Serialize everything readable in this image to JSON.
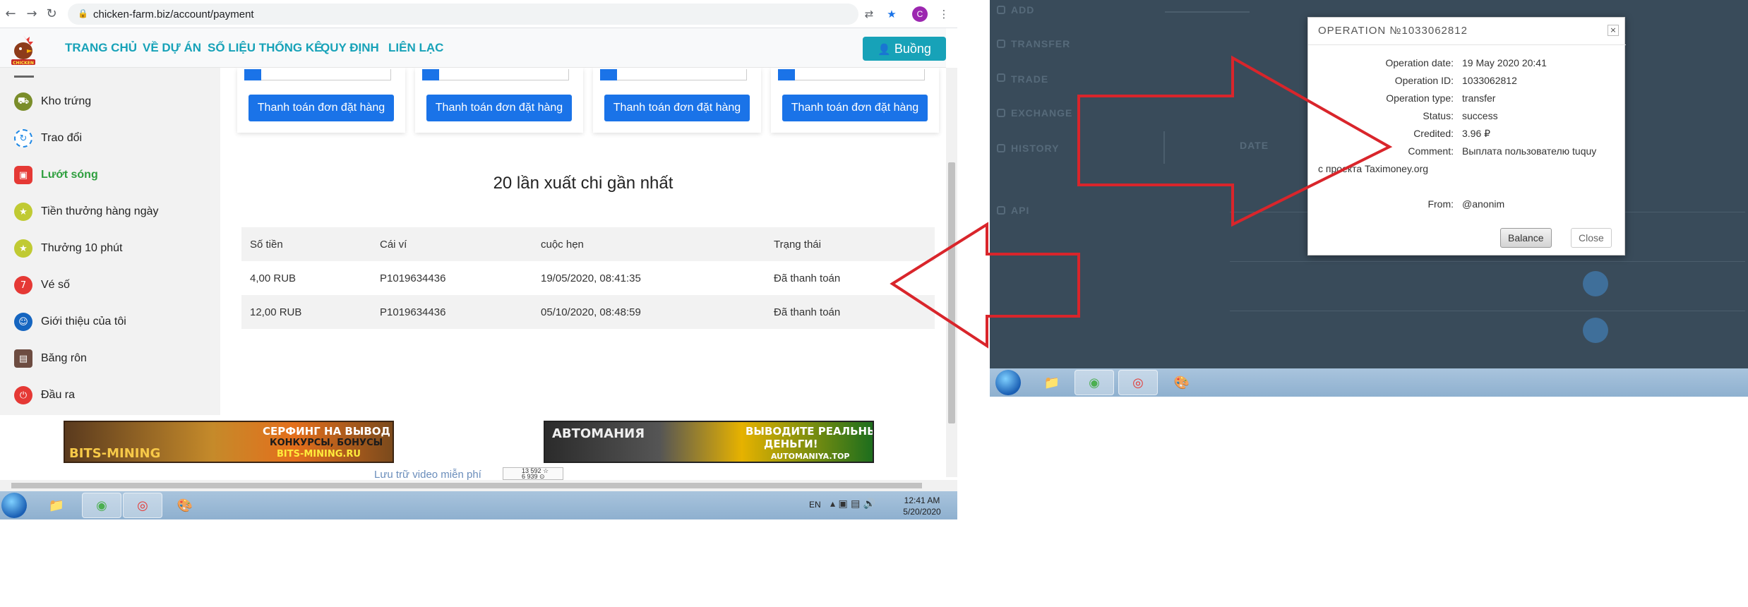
{
  "browser": {
    "url": "chicken-farm.biz/account/payment",
    "profile_initial": "C",
    "nav_back": "←",
    "nav_forward": "→",
    "nav_reload": "↻",
    "lock_icon": "🔒"
  },
  "site": {
    "nav": [
      "TRANG CHỦ",
      "VỀ DỰ ÁN",
      "SỐ LIỆU THỐNG KÊ",
      "QUY ĐỊNH",
      "LIÊN LẠC"
    ],
    "room_button": "Buồng",
    "logo_text": "CHICKEN"
  },
  "sidebar": {
    "items": [
      {
        "label": "Kho trứng",
        "icon": "egg-cart-icon",
        "color": "#7a8d2a"
      },
      {
        "label": "Trao đổi",
        "icon": "exchange-icon",
        "color": "#1e88e5"
      },
      {
        "label": "Lướt sóng",
        "icon": "surf-icon",
        "color": "#e53935",
        "active": true
      },
      {
        "label": "Tiền thưởng hàng ngày",
        "icon": "daily-bonus-icon",
        "color": "#c0ca33"
      },
      {
        "label": "Thưởng 10 phút",
        "icon": "ten-minute-bonus-icon",
        "color": "#c0ca33"
      },
      {
        "label": "Vé số",
        "icon": "lottery-icon",
        "color": "#e53935"
      },
      {
        "label": "Giới thiệu của tôi",
        "icon": "referral-icon",
        "color": "#1565c0"
      },
      {
        "label": "Băng rôn",
        "icon": "banner-icon",
        "color": "#6d4c41"
      },
      {
        "label": "Đầu ra",
        "icon": "logout-icon",
        "color": "#e53935"
      }
    ]
  },
  "payment_cards": [
    {
      "button": "Thanh toán đơn đặt hàng"
    },
    {
      "button": "Thanh toán đơn đặt hàng"
    },
    {
      "button": "Thanh toán đơn đặt hàng"
    },
    {
      "button": "Thanh toán đơn đặt hàng"
    }
  ],
  "history": {
    "title": "20 lần xuất chi gần nhất",
    "columns": [
      "Số tiền",
      "Cái ví",
      "cuộc hẹn",
      "Trạng thái"
    ],
    "rows": [
      [
        "4,00 RUB",
        "P1019634436",
        "19/05/2020, 08:41:35",
        "Đã thanh toán"
      ],
      [
        "12,00 RUB",
        "P1019634436",
        "05/10/2020, 08:48:59",
        "Đã thanh toán"
      ]
    ]
  },
  "ads": {
    "ad1_line1": "СЕРФИНГ НА ВЫВОД",
    "ad1_line2": "КОНКУРСЫ, БОНУСЫ",
    "ad1_line3": "BITS-MINING.RU",
    "ad1_brand": "BITS-MINING",
    "ad2_brand": "АВТОМАНИЯ",
    "ad2_line1": "ВЫВОДИТЕ РЕАЛЬНЫЕ",
    "ad2_line2": "ДЕНЬГИ!",
    "ad2_line3": "AUTOMANIYA.TOP",
    "broken_image_alt": "Lưu trữ video miễn phí",
    "counter_line1": "13 592 ☆",
    "counter_line2": "6 939 ⊙"
  },
  "taskbar_left": {
    "lang": "EN",
    "time": "12:41 AM",
    "date": "5/20/2020"
  },
  "dim_nav": [
    "ADD",
    "TRANSFER",
    "TRADE",
    "EXCHANGE",
    "HISTORY",
    "API"
  ],
  "dim_table": {
    "col_date": "DATE"
  },
  "dialog": {
    "title": "OPERATION №1033062812",
    "close_glyph": "×",
    "fields": [
      {
        "label": "Operation date:",
        "value": "19 May 2020 20:41"
      },
      {
        "label": "Operation ID:",
        "value": "1033062812"
      },
      {
        "label": "Operation type:",
        "value": "transfer"
      },
      {
        "label": "Status:",
        "value": "success"
      },
      {
        "label": "Credited:",
        "value": "3.96 ₽"
      }
    ],
    "comment_label": "Comment:",
    "comment_value_line1": "Выплата пользователю tuquy",
    "comment_value_line2": "с проекта Taximoney.org",
    "from_label": "From:",
    "from_value": "@anonim",
    "balance_button": "Balance",
    "close_button": "Close"
  },
  "colors": {
    "annotation_arrow": "#d9252b",
    "brand_teal": "#17a2b8",
    "button_blue": "#1a73e8",
    "dark_panel": "#394b5a"
  }
}
